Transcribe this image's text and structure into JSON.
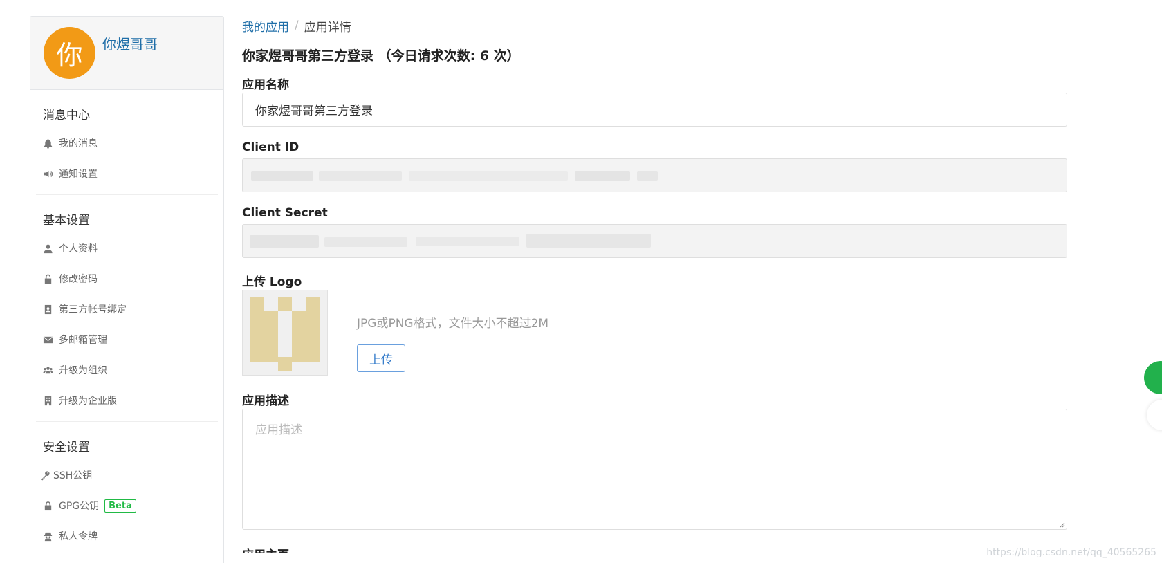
{
  "sidebar": {
    "avatar_text": "你",
    "username": "你煜哥哥",
    "sections": [
      {
        "title": "消息中心",
        "items": [
          {
            "label": "我的消息",
            "icon": "bell-icon"
          },
          {
            "label": "通知设置",
            "icon": "volume-icon"
          }
        ]
      },
      {
        "title": "基本设置",
        "items": [
          {
            "label": "个人资料",
            "icon": "user-icon"
          },
          {
            "label": "修改密码",
            "icon": "unlock-icon"
          },
          {
            "label": "第三方帐号绑定",
            "icon": "contact-card-icon"
          },
          {
            "label": "多邮箱管理",
            "icon": "mail-icon"
          },
          {
            "label": "升级为组织",
            "icon": "users-icon"
          },
          {
            "label": "升级为企业版",
            "icon": "building-icon"
          }
        ]
      },
      {
        "title": "安全设置",
        "items": [
          {
            "label": "SSH公钥",
            "icon": "key-icon"
          },
          {
            "label": "GPG公钥",
            "icon": "lock-icon",
            "badge": "Beta"
          },
          {
            "label": "私人令牌",
            "icon": "agent-icon"
          }
        ]
      }
    ]
  },
  "breadcrumb": {
    "parent": "我的应用",
    "separator": "/",
    "current": "应用详情"
  },
  "app": {
    "title": "你家煜哥哥第三方登录 （今日请求次数: 6 次）",
    "name_label": "应用名称",
    "name_value": "你家煜哥哥第三方登录",
    "client_id_label": "Client ID",
    "client_secret_label": "Client Secret",
    "logo_label": "上传 Logo",
    "logo_hint": "JPG或PNG格式，文件大小不超过2M",
    "upload_button": "上传",
    "desc_label": "应用描述",
    "desc_placeholder": "应用描述",
    "next_label": "应用主页"
  },
  "watermark": "https://blog.csdn.net/qq_40565265",
  "colors": {
    "avatar": "#f29a16",
    "link": "#1f6ea8",
    "beta": "#21ba45",
    "upload_border": "#6aa0de",
    "float_button": "#22b14c"
  }
}
